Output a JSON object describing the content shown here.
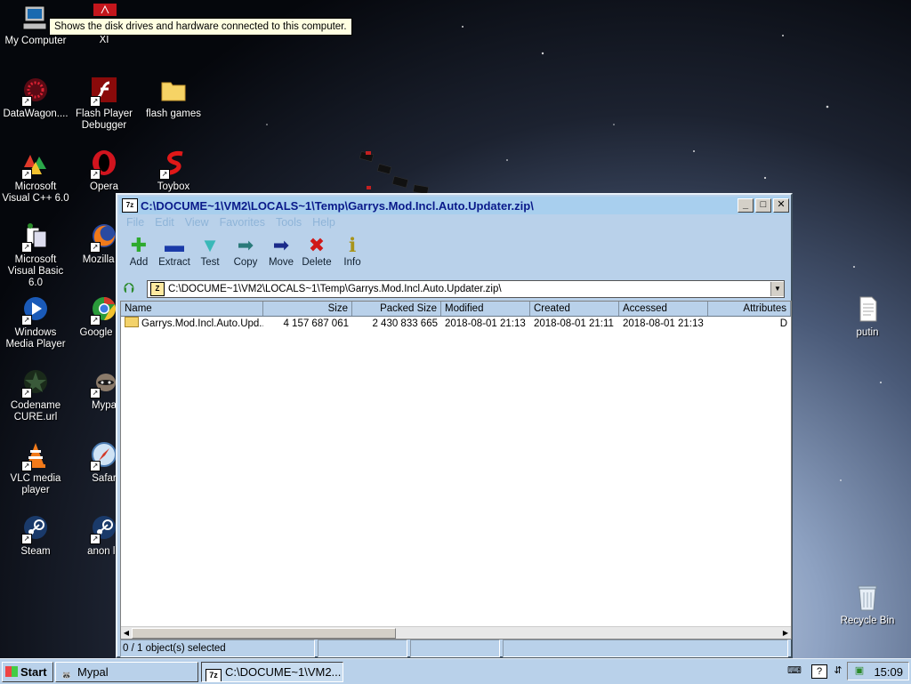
{
  "desktop": {
    "tooltip": "Shows the disk drives and hardware connected to this computer.",
    "icons": [
      {
        "label": "My Computer"
      },
      {
        "label": "Adobe Reader XI"
      },
      {
        "label": "DataWagon...."
      },
      {
        "label": "Flash Player Debugger"
      },
      {
        "label": "flash games"
      },
      {
        "label": "Microsoft Visual C++ 6.0"
      },
      {
        "label": "Opera"
      },
      {
        "label": "Toybox"
      },
      {
        "label": "Microsoft Visual Basic 6.0"
      },
      {
        "label": "Mozilla Fi"
      },
      {
        "label": "Windows Media Player"
      },
      {
        "label": "Google Ch"
      },
      {
        "label": "Codename CURE.url"
      },
      {
        "label": "Mypa"
      },
      {
        "label": "VLC media player"
      },
      {
        "label": "Safar"
      },
      {
        "label": "Steam"
      },
      {
        "label": "anon lo"
      },
      {
        "label": "putin"
      },
      {
        "label": "Recycle Bin"
      }
    ]
  },
  "window": {
    "app_icon": "7z",
    "title": "C:\\DOCUME~1\\VM2\\LOCALS~1\\Temp\\Garrys.Mod.Incl.Auto.Updater.zip\\",
    "controls": {
      "minimize": "_",
      "maximize": "□",
      "close": "✕"
    },
    "menu": [
      "File",
      "Edit",
      "View",
      "Favorites",
      "Tools",
      "Help"
    ],
    "toolbar": [
      {
        "label": "Add",
        "icon": "plus-icon",
        "glyph": "✚",
        "color": "#2eaa2e"
      },
      {
        "label": "Extract",
        "icon": "minus-icon",
        "glyph": "▬",
        "color": "#1a3aa8"
      },
      {
        "label": "Test",
        "icon": "check-icon",
        "glyph": "▼",
        "color": "#3ab8b8"
      },
      {
        "label": "Copy",
        "icon": "arrow-right-icon",
        "glyph": "➡",
        "color": "#2a7a7a"
      },
      {
        "label": "Move",
        "icon": "arrow-right-icon",
        "glyph": "➡",
        "color": "#1a2a8a"
      },
      {
        "label": "Delete",
        "icon": "delete-icon",
        "glyph": "✖",
        "color": "#d01818"
      },
      {
        "label": "Info",
        "icon": "info-icon",
        "glyph": "ℹ",
        "color": "#a8941a"
      }
    ],
    "address": "C:\\DOCUME~1\\VM2\\LOCALS~1\\Temp\\Garrys.Mod.Incl.Auto.Updater.zip\\",
    "columns": [
      "Name",
      "Size",
      "Packed Size",
      "Modified",
      "Created",
      "Accessed",
      "Attributes"
    ],
    "rows": [
      {
        "name": "Garrys.Mod.Incl.Auto.Upd...",
        "size": "4 157 687 061",
        "packed": "2 430 833 665",
        "modified": "2018-08-01 21:13",
        "created": "2018-08-01 21:11",
        "accessed": "2018-08-01 21:13",
        "attributes": "D"
      }
    ],
    "status": "0 / 1 object(s) selected"
  },
  "taskbar": {
    "start": "Start",
    "tasks": [
      {
        "label": "Mypal"
      },
      {
        "label": "C:\\DOCUME~1\\VM2..."
      }
    ],
    "clock": "15:09"
  }
}
